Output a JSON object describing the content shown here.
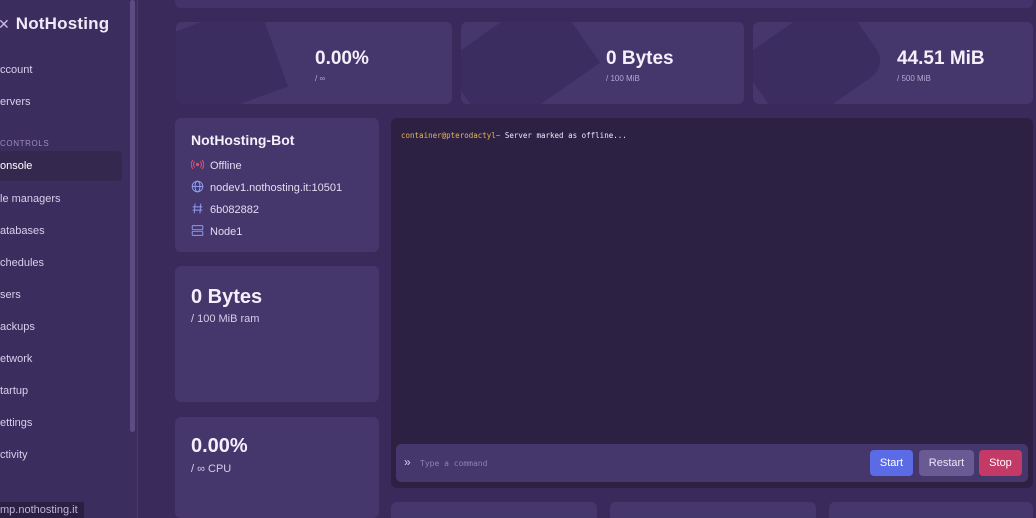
{
  "sidebar": {
    "brand": "NotHosting",
    "items_top": [
      {
        "label": "ccount"
      },
      {
        "label": "ervers"
      }
    ],
    "section_label": "CONTROLS",
    "items": [
      {
        "label": "onsole"
      },
      {
        "label": "le managers"
      },
      {
        "label": "atabases"
      },
      {
        "label": "chedules"
      },
      {
        "label": "sers"
      },
      {
        "label": "ackups"
      },
      {
        "label": "etwork"
      },
      {
        "label": "tartup"
      },
      {
        "label": "ettings"
      },
      {
        "label": "ctivity"
      }
    ],
    "footer_domain": "mp.nothosting.it"
  },
  "stats": [
    {
      "value": "0.00%",
      "sub": "/ ∞"
    },
    {
      "value": "0 Bytes",
      "sub": "/ 100 MiB"
    },
    {
      "value": "44.51 MiB",
      "sub": "/ 500 MiB"
    }
  ],
  "server": {
    "name": "NotHosting-Bot",
    "status": "Offline",
    "address": "nodev1.nothosting.it:10501",
    "id": "6b082882",
    "node": "Node1",
    "status_color": "#e0506a"
  },
  "memory": {
    "value": "0 Bytes",
    "sub": "/ 100 MiB ram"
  },
  "cpu": {
    "value": "0.00%",
    "sub": "/ ∞ CPU"
  },
  "console": {
    "prompt": "container@pterodactyl~",
    "message": " Server marked as offline..."
  },
  "command": {
    "placeholder": "Type a command"
  },
  "buttons": {
    "start": "Start",
    "restart": "Restart",
    "stop": "Stop"
  }
}
